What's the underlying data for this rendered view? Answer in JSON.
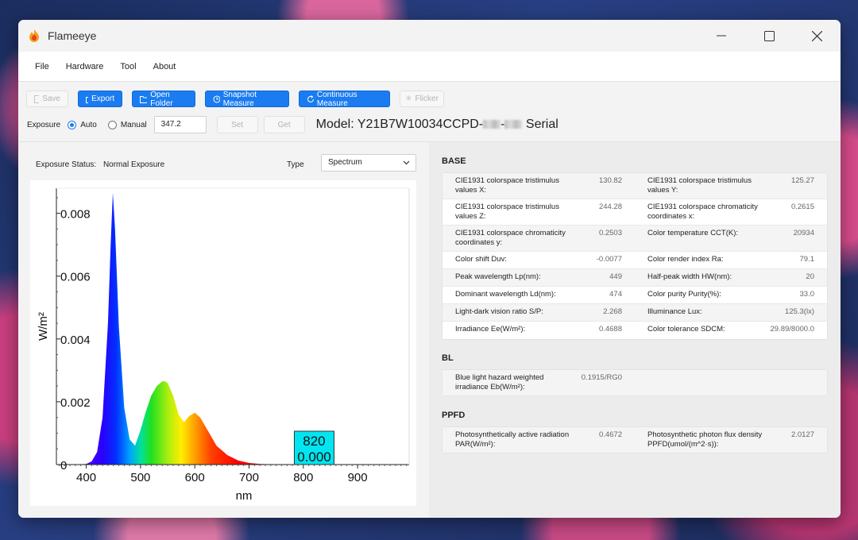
{
  "app": {
    "title": "Flameeye"
  },
  "menu": [
    "File",
    "Hardware",
    "Tool",
    "About"
  ],
  "toolbar": {
    "save": "Save",
    "export": "Export",
    "open_folder": "Open Folder",
    "snapshot": "Snapshot Measure",
    "continuous": "Continuous Measure",
    "flicker": "Flicker",
    "exposure_label": "Exposure",
    "auto_label": "Auto",
    "manual_label": "Manual",
    "exposure_value": "347.2",
    "set_label": "Set",
    "get_label": "Get",
    "model_prefix": "Model: Y21B7W10034CCPD-",
    "model_suffix": "Serial"
  },
  "left": {
    "exposure_status_label": "Exposure Status:",
    "exposure_status_value": "Normal Exposure",
    "type_label": "Type",
    "type_value": "Spectrum"
  },
  "chart_data": {
    "type": "area",
    "xlabel": "nm",
    "ylabel": "W/m²",
    "xlim": [
      345,
      995
    ],
    "ylim": [
      0,
      0.0088
    ],
    "xticks": [
      400,
      500,
      600,
      700,
      800,
      900
    ],
    "yticks": [
      0,
      0.002,
      0.004,
      0.006,
      0.008
    ],
    "ytick_labels": [
      "0",
      "0.002",
      "0.004",
      "0.006",
      "0.008"
    ],
    "grid": false,
    "x": [
      380,
      400,
      410,
      420,
      430,
      440,
      445,
      449,
      453,
      460,
      470,
      480,
      490,
      500,
      510,
      520,
      530,
      540,
      545,
      550,
      560,
      570,
      580,
      590,
      600,
      610,
      620,
      630,
      640,
      660,
      680,
      700,
      720,
      740,
      780
    ],
    "values": [
      0,
      2e-05,
      0.0001,
      0.0004,
      0.0015,
      0.0045,
      0.007,
      0.00865,
      0.0075,
      0.0044,
      0.0018,
      0.0008,
      0.0006,
      0.0011,
      0.0017,
      0.0022,
      0.0025,
      0.00265,
      0.00265,
      0.0026,
      0.0022,
      0.0016,
      0.00135,
      0.00155,
      0.00165,
      0.0015,
      0.0012,
      0.0009,
      0.0006,
      0.0003,
      0.00013,
      5e-05,
      2e-05,
      1e-05,
      0
    ],
    "cursor_box": [
      "820",
      "0.000"
    ]
  },
  "base": {
    "title": "BASE",
    "rows": [
      [
        {
          "label": "CIE1931 colorspace tristimulus values X:",
          "value": "130.82"
        },
        {
          "label": "CIE1931 colorspace tristimulus values Y:",
          "value": "125.27"
        }
      ],
      [
        {
          "label": "CIE1931 colorspace tristimulus values Z:",
          "value": "244.28"
        },
        {
          "label": "CIE1931 colorspace chromaticity coordinates x:",
          "value": "0.2615"
        }
      ],
      [
        {
          "label": "CIE1931 colorspace chromaticity coordinates y:",
          "value": "0.2503"
        },
        {
          "label": "Color temperature CCT(K):",
          "value": "20934"
        }
      ],
      [
        {
          "label": "Color shift Duv:",
          "value": "-0.0077"
        },
        {
          "label": "Color render index Ra:",
          "value": "79.1"
        }
      ],
      [
        {
          "label": "Peak wavelength Lp(nm):",
          "value": "449"
        },
        {
          "label": "Half-peak width HW(nm):",
          "value": "20"
        }
      ],
      [
        {
          "label": "Dominant wavelength Ld(nm):",
          "value": "474"
        },
        {
          "label": "Color purity Purity(%):",
          "value": "33.0"
        }
      ],
      [
        {
          "label": "Light-dark vision ratio S/P:",
          "value": "2.268"
        },
        {
          "label": "Illuminance Lux:",
          "value": "125.3(lx)"
        }
      ],
      [
        {
          "label": "Irradiance Ee(W/m²):",
          "value": "0.4688"
        },
        {
          "label": "Color tolerance SDCM:",
          "value": "29.89/8000.0"
        }
      ]
    ]
  },
  "bl": {
    "title": "BL",
    "rows": [
      [
        {
          "label": "Blue light hazard weighted irradiance Eb(W/m²):",
          "value": "0.1915/RG0"
        },
        {
          "label": "",
          "value": ""
        }
      ]
    ]
  },
  "ppfd": {
    "title": "PPFD",
    "rows": [
      [
        {
          "label": "Photosynthetically active radiation PAR(W/m²):",
          "value": "0.4672"
        },
        {
          "label": "Photosynthetic photon flux density PPFD(umol/(m^2·s)):",
          "value": "2.0127"
        }
      ]
    ]
  }
}
